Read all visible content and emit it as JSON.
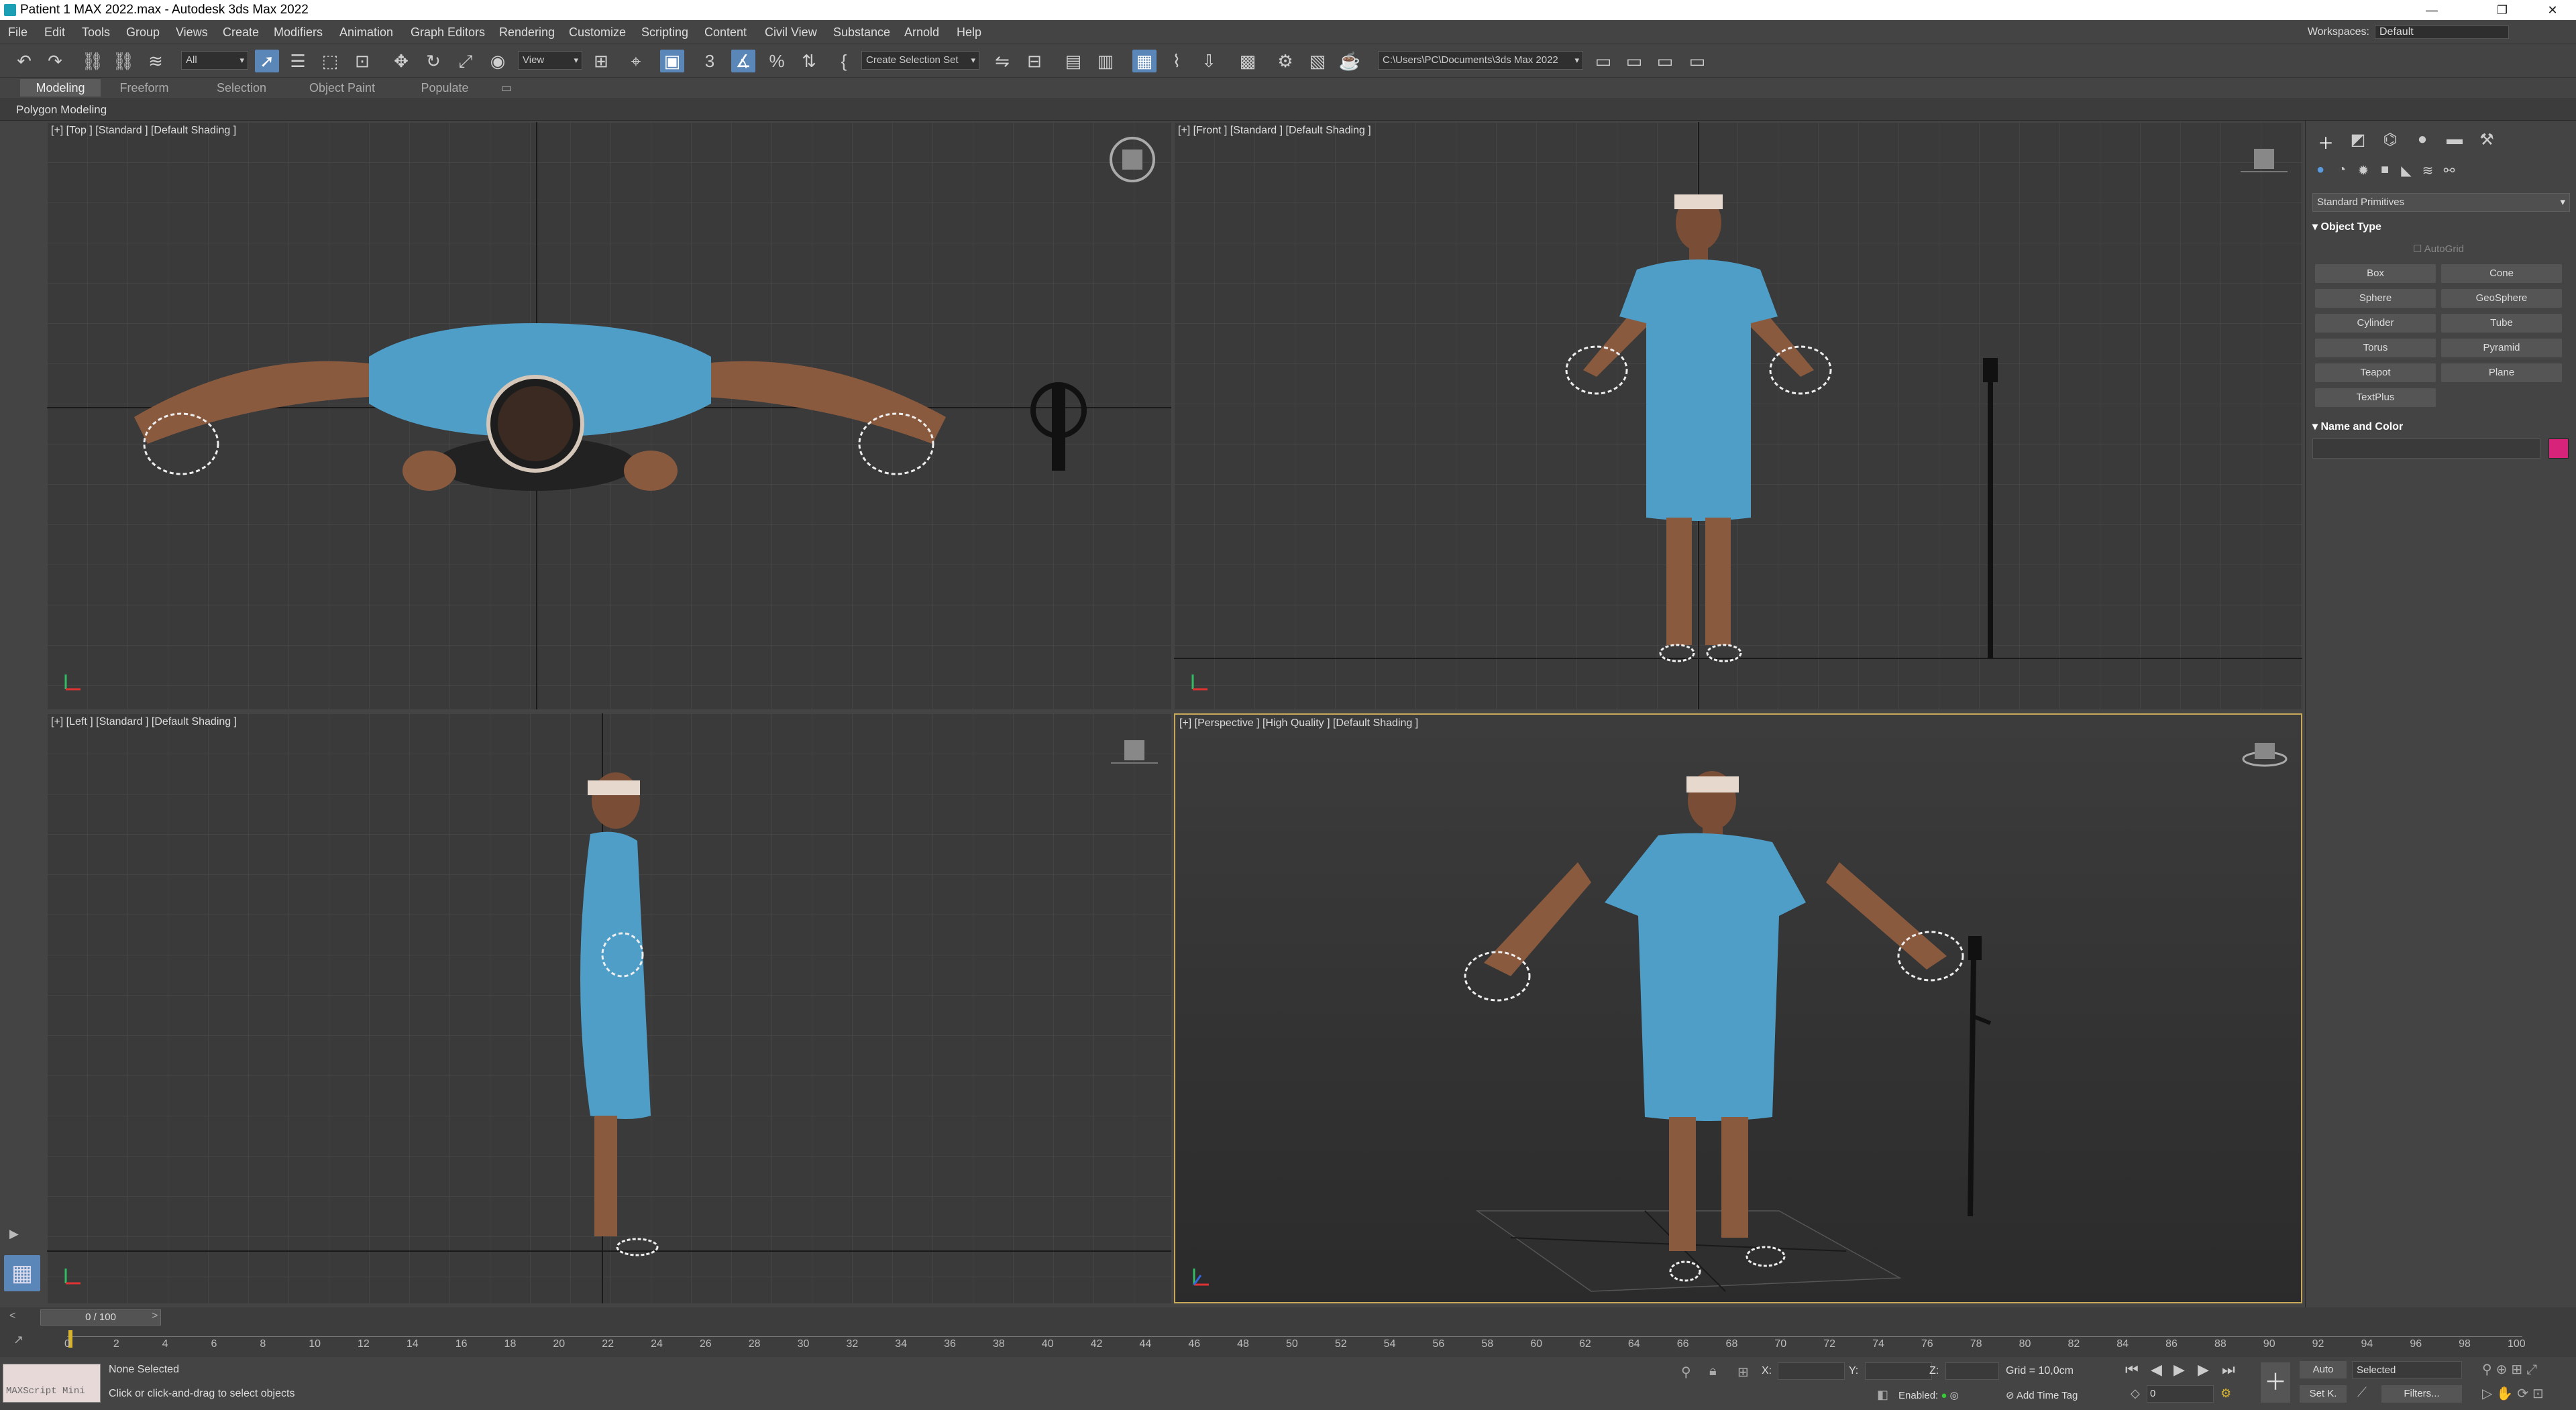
{
  "window": {
    "title": "Patient 1 MAX 2022.max - Autodesk 3ds Max 2022"
  },
  "menu": [
    "File",
    "Edit",
    "Tools",
    "Group",
    "Views",
    "Create",
    "Modifiers",
    "Animation",
    "Graph Editors",
    "Rendering",
    "Customize",
    "Scripting",
    "Content",
    "Civil View",
    "Substance",
    "Arnold",
    "Help"
  ],
  "workspace": {
    "label": "Workspaces:",
    "value": "Default"
  },
  "toolbar": {
    "selection_filter": "All",
    "ref_coord": "View",
    "named_selection": "Create Selection Set",
    "project_path": "C:\\Users\\PC\\Documents\\3ds Max 2022"
  },
  "ribbon": {
    "tabs": [
      "Modeling",
      "Freeform",
      "Selection",
      "Object Paint",
      "Populate"
    ],
    "active": "Modeling",
    "sub": "Polygon Modeling"
  },
  "viewports": {
    "top": {
      "label": "[+] [Top ] [Standard ] [Default Shading ]"
    },
    "front": {
      "label": "[+] [Front ] [Standard ] [Default Shading ]"
    },
    "left": {
      "label": "[+] [Left ] [Standard ] [Default Shading ]"
    },
    "perspective": {
      "label": "[+] [Perspective ] [High Quality ] [Default Shading ]"
    }
  },
  "command_panel": {
    "category": "Standard Primitives",
    "object_type_title": "Object Type",
    "autogrid": "AutoGrid",
    "buttons": [
      "Box",
      "Cone",
      "Sphere",
      "GeoSphere",
      "Cylinder",
      "Tube",
      "Torus",
      "Pyramid",
      "Teapot",
      "Plane",
      "TextPlus"
    ],
    "name_color_title": "Name and Color",
    "object_color": "#d8237a"
  },
  "timeline": {
    "slider": "0 / 100",
    "ticks": [
      "0",
      "2",
      "4",
      "6",
      "8",
      "10",
      "12",
      "14",
      "16",
      "18",
      "20",
      "22",
      "24",
      "26",
      "28",
      "30",
      "32",
      "34",
      "36",
      "38",
      "40",
      "42",
      "44",
      "46",
      "48",
      "50",
      "52",
      "54",
      "56",
      "58",
      "60",
      "62",
      "64",
      "66",
      "68",
      "70",
      "72",
      "74",
      "76",
      "78",
      "80",
      "82",
      "84",
      "86",
      "88",
      "90",
      "92",
      "94",
      "96",
      "98",
      "100"
    ]
  },
  "status": {
    "maxscript": "MAXScript Mini",
    "selection": "None Selected",
    "prompt": "Click or click-and-drag to select objects",
    "x_label": "X:",
    "y_label": "Y:",
    "z_label": "Z:",
    "grid": "Grid = 10,0cm",
    "enabled": "Enabled:",
    "add_time_tag": "Add Time Tag",
    "auto": "Auto",
    "set_key": "Set K.",
    "selected": "Selected",
    "filters": "Filters...",
    "frame": "0"
  },
  "colors": {
    "gown": "#4e9ec8",
    "skin": "#8a5a3e",
    "active_border": "#c8a85a",
    "accent": "#5a86b8"
  }
}
